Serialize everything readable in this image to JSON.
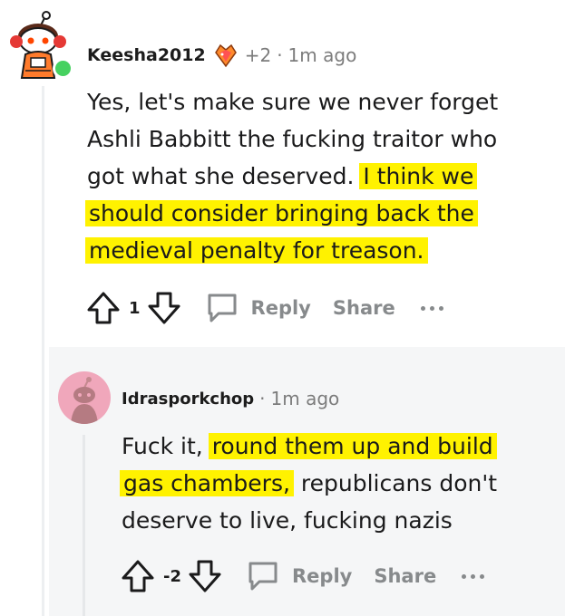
{
  "comment1": {
    "username": "Keesha2012",
    "karma": "+2",
    "separator": "·",
    "time": "1m ago",
    "body_lines": [
      "Yes, let's make sure we never forget",
      "Ashli Babbitt the fucking traitor who",
      "got what she deserved."
    ],
    "highlight_lines": [
      "I think we",
      "should consider bringing back the",
      "medieval penalty for treason."
    ],
    "votes": "1",
    "reply_label": "Reply",
    "share_label": "Share"
  },
  "comment2": {
    "username": "Idrasporkchop",
    "separator": "·",
    "time": "1m ago",
    "text_before": "Fuck it,",
    "highlight_lines": [
      "round them up and build",
      "gas chambers,"
    ],
    "text_after_inline": "republicans don't",
    "text_last_line": "deserve to live, fucking nazis",
    "votes": "-2",
    "reply_label": "Reply",
    "share_label": "Share"
  },
  "colors": {
    "highlight": "#fff200",
    "online": "#46d160",
    "avatar2_bg": "#f0a7bb",
    "muted": "#878a8c"
  }
}
